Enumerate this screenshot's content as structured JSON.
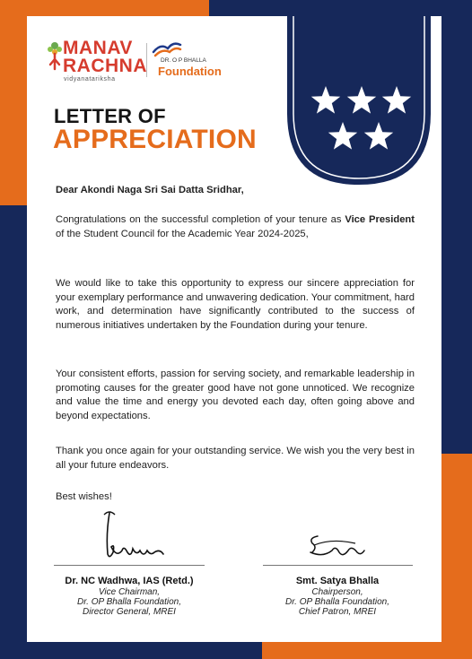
{
  "logo": {
    "primary_line1": "MANAV",
    "primary_line2": "RACHNA",
    "tagline": "vidyanatariksha",
    "partner_line1": "DR. O P BHALLA",
    "partner_line2": "Foundation"
  },
  "title": {
    "line1": "LETTER OF",
    "line2": "APPRECIATION"
  },
  "letter": {
    "salutation": "Dear Akondi Naga Sri Sai Datta Sridhar,",
    "p1_before": "Congratulations on the successful completion of your tenure as ",
    "p1_bold": "Vice President",
    "p1_after": " of the Student Council for the Academic Year 2024-2025,",
    "p2": "We would like to take this opportunity to express our sincere appreciation for your exemplary performance and unwavering dedication. Your commitment, hard work, and determination have significantly contributed to the success of numerous initiatives undertaken by the Foundation during your tenure.",
    "p3": "Your consistent efforts, passion for serving society, and remarkable leadership in promoting causes for the greater good have not gone unnoticed. We recognize and value the time and energy you devoted each day, often going above and beyond expectations.",
    "p4": "Thank you once again for your outstanding service. We wish you the very best in all your future endeavors.",
    "closing": "Best wishes!"
  },
  "signatories": [
    {
      "name": "Dr. NC Wadhwa, IAS (Retd.)",
      "role1": "Vice Chairman,",
      "role2": "Dr. OP Bhalla Foundation,",
      "role3": "Director General, MREI"
    },
    {
      "name": "Smt. Satya Bhalla",
      "role1": "Chairperson,",
      "role2": "Dr. OP Bhalla Foundation,",
      "role3": "Chief Patron, MREI"
    }
  ],
  "colors": {
    "navy": "#16285a",
    "orange": "#e56c1c",
    "logo_red": "#d63c2e"
  },
  "badge": {
    "star_count": 5,
    "icon": "star-icon"
  }
}
